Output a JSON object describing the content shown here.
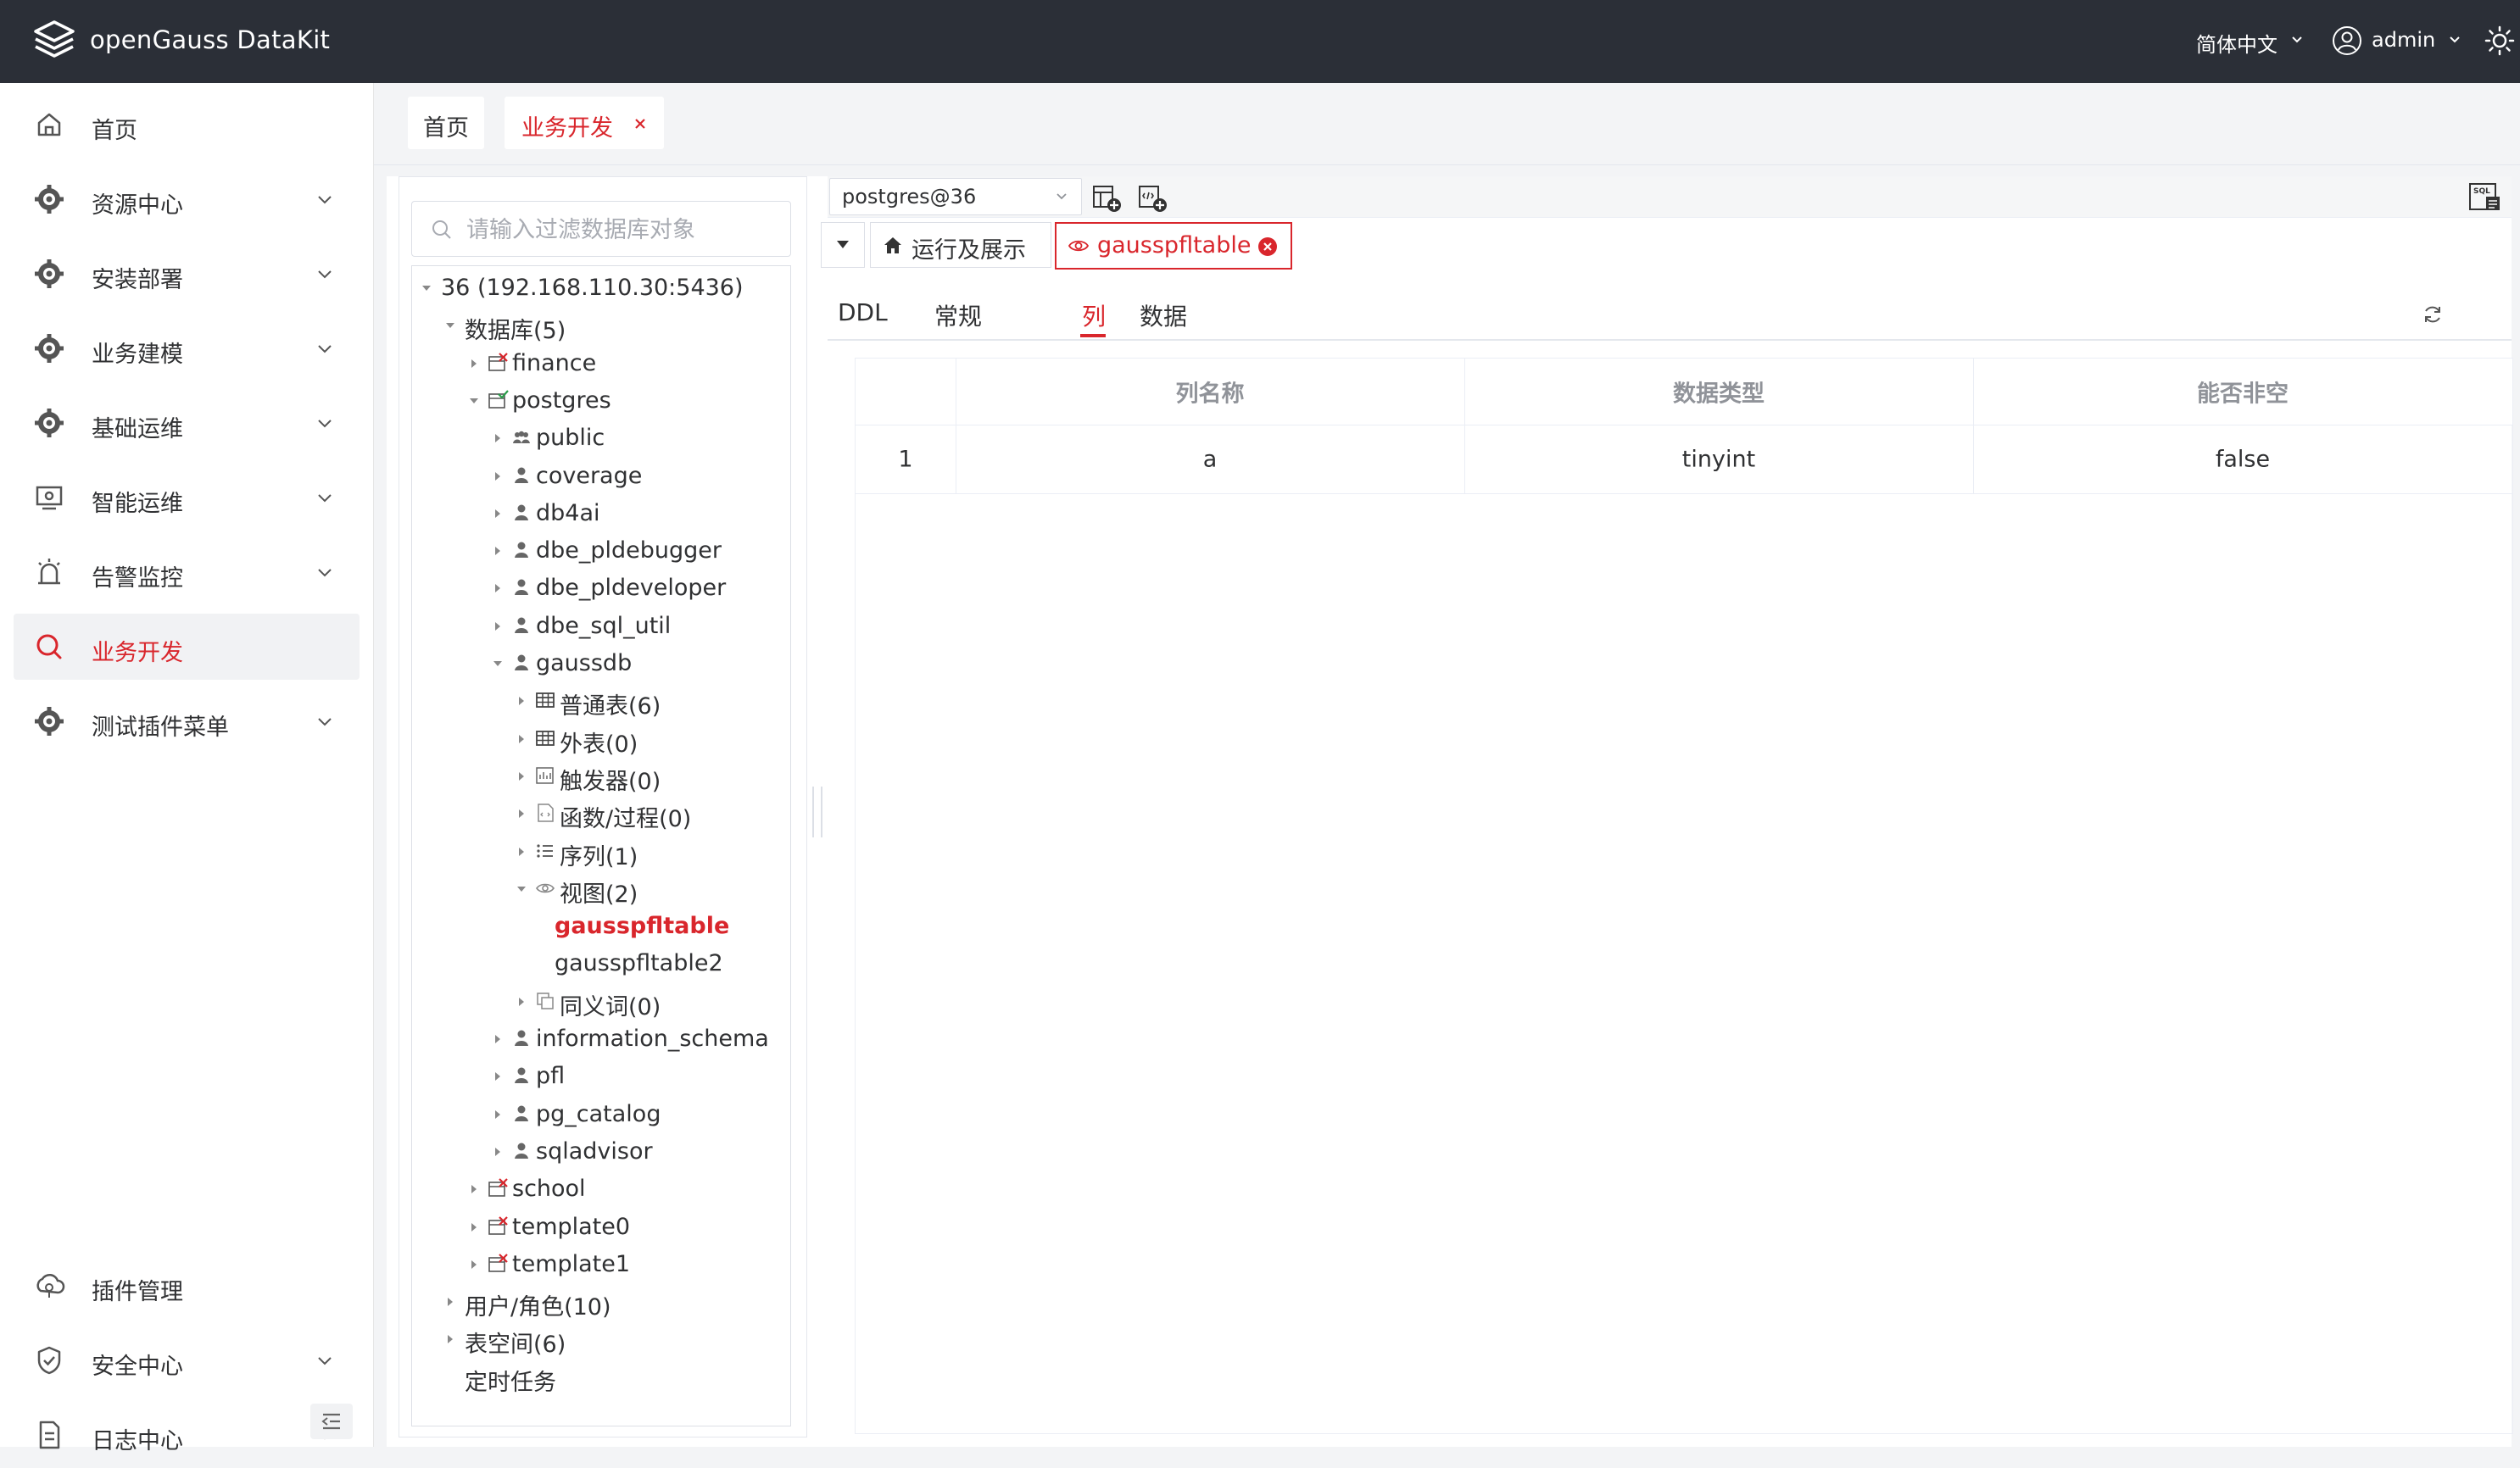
{
  "header": {
    "app_title": "openGauss DataKit",
    "language": "简体中文",
    "username": "admin"
  },
  "sidebar": {
    "items": [
      {
        "label": "首页",
        "icon": "home-icon",
        "expandable": false,
        "active": false
      },
      {
        "label": "资源中心",
        "icon": "gear-icon",
        "expandable": true,
        "active": false
      },
      {
        "label": "安装部署",
        "icon": "gear-icon",
        "expandable": true,
        "active": false
      },
      {
        "label": "业务建模",
        "icon": "gear-icon",
        "expandable": true,
        "active": false
      },
      {
        "label": "基础运维",
        "icon": "gear-icon",
        "expandable": true,
        "active": false
      },
      {
        "label": "智能运维",
        "icon": "monitor-icon",
        "expandable": true,
        "active": false
      },
      {
        "label": "告警监控",
        "icon": "alarm-icon",
        "expandable": true,
        "active": false
      },
      {
        "label": "业务开发",
        "icon": "search-icon",
        "expandable": false,
        "active": true
      },
      {
        "label": "测试插件菜单",
        "icon": "gear-icon",
        "expandable": true,
        "active": false
      },
      {
        "label": "插件管理",
        "icon": "plugin-icon",
        "expandable": false,
        "active": false
      },
      {
        "label": "安全中心",
        "icon": "shield-icon",
        "expandable": true,
        "active": false
      },
      {
        "label": "日志中心",
        "icon": "document-icon",
        "expandable": true,
        "active": false
      }
    ]
  },
  "page_tabs": [
    {
      "label": "首页",
      "active": false,
      "closable": false
    },
    {
      "label": "业务开发",
      "active": true,
      "closable": true
    }
  ],
  "tree": {
    "search_placeholder": "请输入过滤数据库对象",
    "nodes": [
      {
        "label": "36 (192.168.110.30:5436)",
        "depth": 0,
        "arrow": "down",
        "icon": "none"
      },
      {
        "label": "数据库(5)",
        "depth": 1,
        "arrow": "down",
        "icon": "none"
      },
      {
        "label": "finance",
        "depth": 2,
        "arrow": "right",
        "icon": "db-disconnected-icon"
      },
      {
        "label": "postgres",
        "depth": 2,
        "arrow": "down",
        "icon": "db-connected-icon"
      },
      {
        "label": "public",
        "depth": 3,
        "arrow": "right",
        "icon": "group-icon"
      },
      {
        "label": "coverage",
        "depth": 3,
        "arrow": "right",
        "icon": "user-icon"
      },
      {
        "label": "db4ai",
        "depth": 3,
        "arrow": "right",
        "icon": "user-icon"
      },
      {
        "label": "dbe_pldebugger",
        "depth": 3,
        "arrow": "right",
        "icon": "user-icon"
      },
      {
        "label": "dbe_pldeveloper",
        "depth": 3,
        "arrow": "right",
        "icon": "user-icon"
      },
      {
        "label": "dbe_sql_util",
        "depth": 3,
        "arrow": "right",
        "icon": "user-icon"
      },
      {
        "label": "gaussdb",
        "depth": 3,
        "arrow": "down",
        "icon": "user-icon"
      },
      {
        "label": "普通表(6)",
        "depth": 4,
        "arrow": "right",
        "icon": "table-icon"
      },
      {
        "label": "外表(0)",
        "depth": 4,
        "arrow": "right",
        "icon": "table-icon"
      },
      {
        "label": "触发器(0)",
        "depth": 4,
        "arrow": "right",
        "icon": "trigger-icon"
      },
      {
        "label": "函数/过程(0)",
        "depth": 4,
        "arrow": "right",
        "icon": "function-icon"
      },
      {
        "label": "序列(1)",
        "depth": 4,
        "arrow": "right",
        "icon": "sequence-icon"
      },
      {
        "label": "视图(2)",
        "depth": 4,
        "arrow": "down",
        "icon": "eye-icon"
      },
      {
        "label": "gausspfltable",
        "depth": 5,
        "arrow": "none",
        "icon": "none",
        "selected": true
      },
      {
        "label": "gausspfltable2",
        "depth": 5,
        "arrow": "none",
        "icon": "none"
      },
      {
        "label": "同义词(0)",
        "depth": 4,
        "arrow": "right",
        "icon": "synonym-icon"
      },
      {
        "label": "information_schema",
        "depth": 3,
        "arrow": "right",
        "icon": "user-icon"
      },
      {
        "label": "pfl",
        "depth": 3,
        "arrow": "right",
        "icon": "user-icon"
      },
      {
        "label": "pg_catalog",
        "depth": 3,
        "arrow": "right",
        "icon": "user-icon"
      },
      {
        "label": "sqladvisor",
        "depth": 3,
        "arrow": "right",
        "icon": "user-icon"
      },
      {
        "label": "school",
        "depth": 2,
        "arrow": "right",
        "icon": "db-disconnected-icon"
      },
      {
        "label": "template0",
        "depth": 2,
        "arrow": "right",
        "icon": "db-disconnected-icon"
      },
      {
        "label": "template1",
        "depth": 2,
        "arrow": "right",
        "icon": "db-disconnected-icon"
      },
      {
        "label": "用户/角色(10)",
        "depth": 1,
        "arrow": "right",
        "icon": "none"
      },
      {
        "label": "表空间(6)",
        "depth": 1,
        "arrow": "right",
        "icon": "none"
      },
      {
        "label": "定时任务",
        "depth": 1,
        "arrow": "none",
        "icon": "none"
      }
    ]
  },
  "workspace": {
    "connection": "postgres@36",
    "sub_tabs": [
      {
        "label": "运行及展示",
        "icon": "home-icon",
        "active": false,
        "closable": false
      },
      {
        "label": "gausspfltable",
        "icon": "eye-icon",
        "active": true,
        "closable": true
      }
    ],
    "detail_tabs": [
      {
        "label": "DDL",
        "active": false
      },
      {
        "label": "常规",
        "active": false
      },
      {
        "label": "列",
        "active": true
      },
      {
        "label": "数据",
        "active": false
      }
    ],
    "columns_table": {
      "headers": [
        "",
        "列名称",
        "数据类型",
        "能否非空"
      ],
      "rows": [
        [
          "1",
          "a",
          "tinyint",
          "false"
        ]
      ]
    }
  },
  "colors": {
    "accent": "#d9262c",
    "topbar_bg": "#2b2f37"
  }
}
